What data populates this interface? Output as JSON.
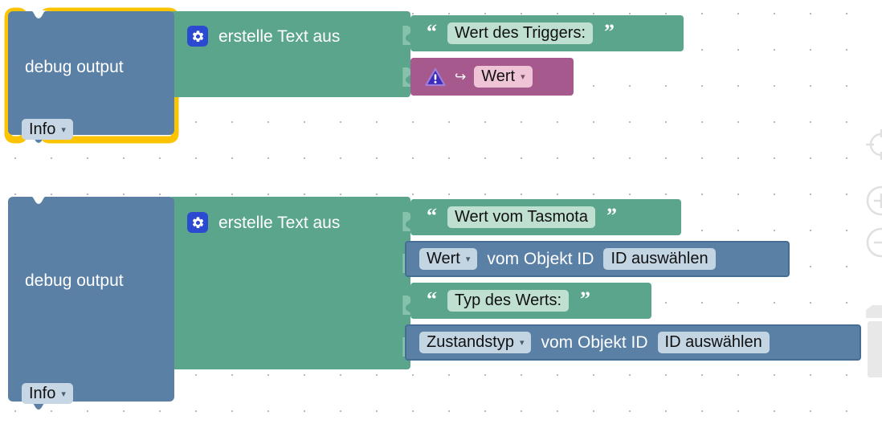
{
  "app": {
    "kind": "blockly-workspace",
    "background_color": "#ffffff",
    "grid_dot_color": "#b8b8c0",
    "selection_color": "#ffcc00"
  },
  "palette": {
    "debug_blue": "#5b80a5",
    "text_green": "#5ba58c",
    "trigger_magenta": "#a5598c",
    "value_blue": "#5b80a5",
    "value_blue_border": "#436f96",
    "field_light_blue": "#c7d6e4",
    "field_light_green": "#bfe0d0",
    "field_light_pink": "#eec4d6",
    "gear_icon_blue": "#2b4ad1"
  },
  "blocks": [
    {
      "id": "debug-1",
      "name": "debug-output-block",
      "selected": true,
      "label": "debug output",
      "severity_dropdown": {
        "value": "Info",
        "caret": "▾"
      },
      "attached": {
        "name": "create-text-block",
        "mutator_icon": "gear-icon",
        "label": "erstelle Text aus",
        "inputs": [
          {
            "type": "text",
            "name": "text-literal",
            "open_quote": "“",
            "close_quote": "”",
            "value": "Wert des Triggers:"
          },
          {
            "type": "trigger-value",
            "name": "trigger-value-block",
            "icon": "warning-triangle-icon",
            "arrow": "↪",
            "dropdown": {
              "value": "Wert",
              "caret": "▾"
            }
          }
        ]
      }
    },
    {
      "id": "debug-2",
      "name": "debug-output-block",
      "selected": false,
      "label": "debug output",
      "severity_dropdown": {
        "value": "Info",
        "caret": "▾"
      },
      "attached": {
        "name": "create-text-block",
        "mutator_icon": "gear-icon",
        "label": "erstelle Text aus",
        "inputs": [
          {
            "type": "text",
            "name": "text-literal",
            "open_quote": "“",
            "close_quote": "”",
            "value": "Wert vom Tasmota"
          },
          {
            "type": "object-getter",
            "name": "get-object-value-block",
            "dropdown": {
              "value": "Wert",
              "caret": "▾"
            },
            "label": "vom Objekt ID",
            "object_id_field": "ID auswählen"
          },
          {
            "type": "text",
            "name": "text-literal",
            "open_quote": "“",
            "close_quote": "”",
            "value": "Typ des Werts:"
          },
          {
            "type": "object-getter",
            "name": "get-object-type-block",
            "dropdown": {
              "value": "Zustandstyp",
              "caret": "▾"
            },
            "label": "vom Objekt ID",
            "object_id_field": "ID auswählen"
          }
        ]
      }
    }
  ],
  "workspace_controls": [
    {
      "name": "center-target-icon",
      "icon": "crosshair"
    },
    {
      "name": "zoom-in-icon",
      "icon": "plus-circle"
    },
    {
      "name": "zoom-out-icon",
      "icon": "minus-circle"
    },
    {
      "name": "trashcan-icon",
      "icon": "trashcan"
    }
  ]
}
